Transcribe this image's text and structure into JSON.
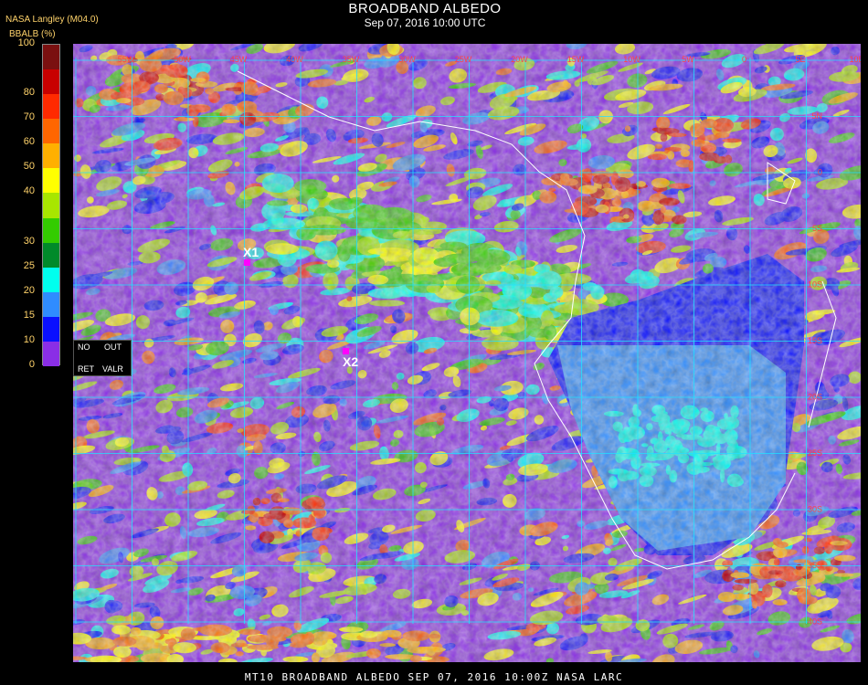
{
  "header": {
    "title": "BROADBAND ALBEDO",
    "datetime": "Sep 07, 2016 10:00 UTC"
  },
  "colorbar": {
    "provider": "NASA Langley (M04.0)",
    "title": "BBALB (%)",
    "ticks": [
      "100",
      "80",
      "70",
      "60",
      "50",
      "40",
      "30",
      "25",
      "20",
      "15",
      "10",
      "0"
    ],
    "segments": [
      {
        "from": 90,
        "to": 100,
        "color": "#7a1010"
      },
      {
        "from": 80,
        "to": 90,
        "color": "#c80000"
      },
      {
        "from": 70,
        "to": 80,
        "color": "#ff2a00"
      },
      {
        "from": 60,
        "to": 70,
        "color": "#ff6600"
      },
      {
        "from": 50,
        "to": 60,
        "color": "#ffb000"
      },
      {
        "from": 40,
        "to": 50,
        "color": "#ffff00"
      },
      {
        "from": 35,
        "to": 40,
        "color": "#a8e600"
      },
      {
        "from": 30,
        "to": 35,
        "color": "#33cc00"
      },
      {
        "from": 25,
        "to": 30,
        "color": "#008a2a"
      },
      {
        "from": 20,
        "to": 25,
        "color": "#00ffee"
      },
      {
        "from": 15,
        "to": 20,
        "color": "#2f8cff"
      },
      {
        "from": 10,
        "to": 15,
        "color": "#0a10ff"
      },
      {
        "from": 0,
        "to": 10,
        "color": "#8a2ee6"
      }
    ]
  },
  "legend_box": {
    "no": "NO",
    "out": "OUT",
    "ret": "RET",
    "valr": "VALR"
  },
  "markers": [
    {
      "label": "X1"
    },
    {
      "label": "X2"
    }
  ],
  "grid_labels": {
    "top": [
      "55W",
      "50W",
      "45W",
      "40W",
      "35W",
      "30W",
      "25W",
      "20W",
      "15W",
      "10W",
      "5W",
      "0",
      "5E",
      "10E"
    ],
    "right": [
      "5N",
      "0",
      "5S",
      "10S",
      "15S",
      "20S",
      "25S",
      "30S",
      "35S",
      "40S"
    ]
  },
  "footer": "MT10  BROADBAND ALBEDO   SEP 07, 2016 10:00Z   NASA LARC"
}
